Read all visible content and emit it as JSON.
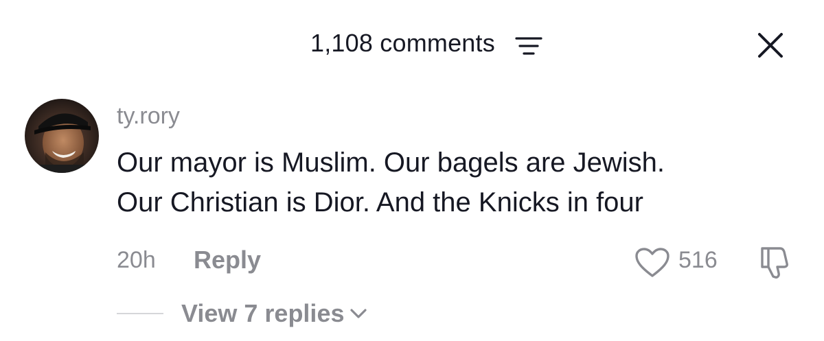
{
  "header": {
    "title": "1,108 comments",
    "sort_icon": "sort-filter-icon",
    "close_icon": "close-icon"
  },
  "comment": {
    "avatar_icon": "avatar",
    "username": "ty.rory",
    "text_lines": [
      "Our mayor is Muslim. Our bagels are Jewish.",
      "Our Christian is Dior. And the Knicks in four"
    ],
    "time": "20h",
    "reply_label": "Reply",
    "like_icon": "heart-icon",
    "like_count": "516",
    "dislike_icon": "thumbs-down-icon",
    "view_replies_label": "View 7 replies",
    "view_replies_icon": "chevron-down-icon"
  },
  "colors": {
    "text_primary": "#161823",
    "text_secondary": "#8a8b91",
    "divider": "#d5d6d9",
    "background": "#ffffff"
  }
}
